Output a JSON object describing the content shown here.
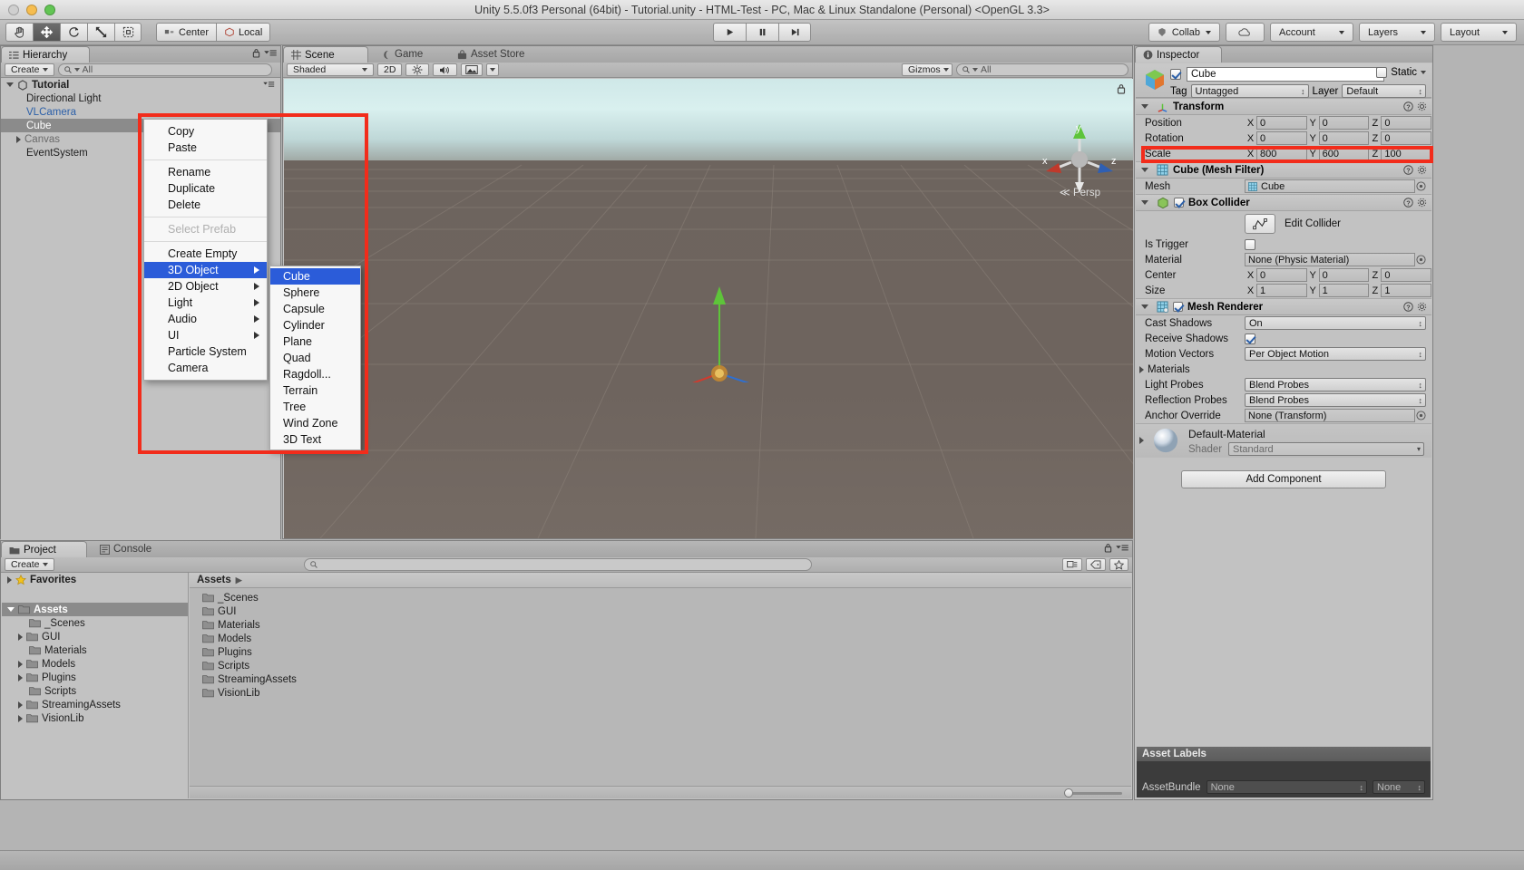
{
  "window": {
    "title": "Unity 5.5.0f3 Personal (64bit) - Tutorial.unity - HTML-Test - PC, Mac & Linux Standalone (Personal) <OpenGL 3.3>"
  },
  "toolbar": {
    "transform_tools": [
      {
        "name": "hand-tool",
        "glyph": "✋",
        "active": false
      },
      {
        "name": "move-tool",
        "glyph": "✥",
        "active": true
      },
      {
        "name": "rotate-tool",
        "glyph": "↻",
        "active": false
      },
      {
        "name": "scale-tool",
        "glyph": "⤡",
        "active": false
      },
      {
        "name": "rect-tool",
        "glyph": "⧉",
        "active": false
      }
    ],
    "pivot_label": "Center",
    "space_label": "Local",
    "play_label": "▶",
    "pause_label": "⎉",
    "step_label": "▶│",
    "collab_label": "Collab",
    "cloud_label": "☁",
    "account_label": "Account",
    "layers_label": "Layers",
    "layout_label": "Layout"
  },
  "hierarchy": {
    "tab_label": "Hierarchy",
    "create_label": "Create",
    "search_placeholder": "All",
    "items": [
      {
        "label": "Tutorial",
        "depth": 0,
        "style": "root",
        "expanded": true
      },
      {
        "label": "Directional Light",
        "depth": 1,
        "style": "normal"
      },
      {
        "label": "VLCamera",
        "depth": 1,
        "style": "blue"
      },
      {
        "label": "Cube",
        "depth": 1,
        "style": "selected"
      },
      {
        "label": "Canvas",
        "depth": 1,
        "style": "gray",
        "expandable": true
      },
      {
        "label": "EventSystem",
        "depth": 1,
        "style": "normal"
      }
    ]
  },
  "scene": {
    "tabs": [
      {
        "label": "Scene",
        "icon": "grid-icon",
        "active": true
      },
      {
        "label": "Game",
        "icon": "gamepad-icon",
        "active": false
      },
      {
        "label": "Asset Store",
        "icon": "store-icon",
        "active": false
      }
    ],
    "shading_mode": "Shaded",
    "mode_2d": "2D",
    "lighting_icon": "sun-icon",
    "audio_icon": "speaker-icon",
    "fx_icon": "image-icon",
    "gizmos_label": "Gizmos",
    "search_placeholder": "All",
    "axis_labels": {
      "x": "x",
      "y": "y",
      "z": "z"
    },
    "persp_label": "Persp"
  },
  "context_menu": {
    "items": [
      {
        "label": "Copy",
        "type": "item"
      },
      {
        "label": "Paste",
        "type": "item"
      },
      {
        "type": "separator"
      },
      {
        "label": "Rename",
        "type": "item"
      },
      {
        "label": "Duplicate",
        "type": "item"
      },
      {
        "label": "Delete",
        "type": "item"
      },
      {
        "type": "separator"
      },
      {
        "label": "Select Prefab",
        "type": "disabled"
      },
      {
        "type": "separator"
      },
      {
        "label": "Create Empty",
        "type": "item"
      },
      {
        "label": "3D Object",
        "type": "submenu",
        "selected": true
      },
      {
        "label": "2D Object",
        "type": "submenu"
      },
      {
        "label": "Light",
        "type": "submenu"
      },
      {
        "label": "Audio",
        "type": "submenu"
      },
      {
        "label": "UI",
        "type": "submenu"
      },
      {
        "label": "Particle System",
        "type": "item"
      },
      {
        "label": "Camera",
        "type": "item"
      }
    ]
  },
  "submenu": {
    "items": [
      {
        "label": "Cube",
        "selected": true
      },
      {
        "label": "Sphere"
      },
      {
        "label": "Capsule"
      },
      {
        "label": "Cylinder"
      },
      {
        "label": "Plane"
      },
      {
        "label": "Quad"
      },
      {
        "label": "Ragdoll..."
      },
      {
        "label": "Terrain"
      },
      {
        "label": "Tree"
      },
      {
        "label": "Wind Zone"
      },
      {
        "label": "3D Text"
      }
    ]
  },
  "project": {
    "tabs": [
      {
        "label": "Project",
        "icon": "folder-icon",
        "active": true
      },
      {
        "label": "Console",
        "icon": "console-icon",
        "active": false
      }
    ],
    "create_label": "Create",
    "tree": [
      {
        "label": "Favorites",
        "depth": 0,
        "icon": "star-icon",
        "expandable": true,
        "bold": true
      },
      {
        "label": "Assets",
        "depth": 0,
        "icon": "folder-icon",
        "expandable": true,
        "expanded": true,
        "selected": true,
        "bold": true
      },
      {
        "label": "_Scenes",
        "depth": 1,
        "icon": "folder-icon"
      },
      {
        "label": "GUI",
        "depth": 1,
        "icon": "folder-icon",
        "expandable": true
      },
      {
        "label": "Materials",
        "depth": 1,
        "icon": "folder-icon"
      },
      {
        "label": "Models",
        "depth": 1,
        "icon": "folder-icon",
        "expandable": true
      },
      {
        "label": "Plugins",
        "depth": 1,
        "icon": "folder-icon",
        "expandable": true
      },
      {
        "label": "Scripts",
        "depth": 1,
        "icon": "folder-icon"
      },
      {
        "label": "StreamingAssets",
        "depth": 1,
        "icon": "folder-icon",
        "expandable": true
      },
      {
        "label": "VisionLib",
        "depth": 1,
        "icon": "folder-icon",
        "expandable": true
      }
    ],
    "breadcrumb": "Assets",
    "contents": [
      {
        "label": "_Scenes"
      },
      {
        "label": "GUI"
      },
      {
        "label": "Materials"
      },
      {
        "label": "Models"
      },
      {
        "label": "Plugins"
      },
      {
        "label": "Scripts"
      },
      {
        "label": "StreamingAssets"
      },
      {
        "label": "VisionLib"
      }
    ],
    "search_placeholder": ""
  },
  "inspector": {
    "tab_label": "Inspector",
    "object_name": "Cube",
    "object_enabled": true,
    "static_label": "Static",
    "tag_label": "Tag",
    "tag_value": "Untagged",
    "layer_label": "Layer",
    "layer_value": "Default",
    "transform": {
      "title": "Transform",
      "rows": [
        {
          "label": "Position",
          "x": "0",
          "y": "0",
          "z": "0",
          "highlighted": false
        },
        {
          "label": "Rotation",
          "x": "0",
          "y": "0",
          "z": "0",
          "highlighted": false
        },
        {
          "label": "Scale",
          "x": "800",
          "y": "600",
          "z": "100",
          "highlighted": true
        }
      ]
    },
    "mesh_filter": {
      "title": "Cube (Mesh Filter)",
      "mesh_label": "Mesh",
      "mesh_value": "Cube"
    },
    "box_collider": {
      "title": "Box Collider",
      "enabled": true,
      "edit_collider_label": "Edit Collider",
      "is_trigger_label": "Is Trigger",
      "is_trigger_value": false,
      "material_label": "Material",
      "material_value": "None (Physic Material)",
      "center_label": "Center",
      "center": {
        "x": "0",
        "y": "0",
        "z": "0"
      },
      "size_label": "Size",
      "size": {
        "x": "1",
        "y": "1",
        "z": "1"
      }
    },
    "mesh_renderer": {
      "title": "Mesh Renderer",
      "enabled": true,
      "rows": [
        {
          "label": "Cast Shadows",
          "value": "On",
          "kind": "popup"
        },
        {
          "label": "Receive Shadows",
          "value": true,
          "kind": "checkbox"
        },
        {
          "label": "Motion Vectors",
          "value": "Per Object Motion",
          "kind": "popup"
        },
        {
          "label": "Materials",
          "value": "",
          "kind": "foldout"
        },
        {
          "label": "Light Probes",
          "value": "Blend Probes",
          "kind": "popup"
        },
        {
          "label": "Reflection Probes",
          "value": "Blend Probes",
          "kind": "popup"
        },
        {
          "label": "Anchor Override",
          "value": "None (Transform)",
          "kind": "object"
        }
      ]
    },
    "material": {
      "title": "Default-Material",
      "shader_label": "Shader",
      "shader_value": "Standard"
    },
    "add_component_label": "Add Component",
    "asset_labels": {
      "title": "Asset Labels",
      "bundle_label": "AssetBundle",
      "bundle_value": "None",
      "variant_value": "None"
    }
  },
  "colors": {
    "highlight_red": "#f22c1b",
    "menu_blue": "#2b5cd9",
    "selection_gray": "#8b8b8b",
    "panel_bg": "#c2c2c2",
    "toolbar_bg": "#b4b4b4"
  }
}
